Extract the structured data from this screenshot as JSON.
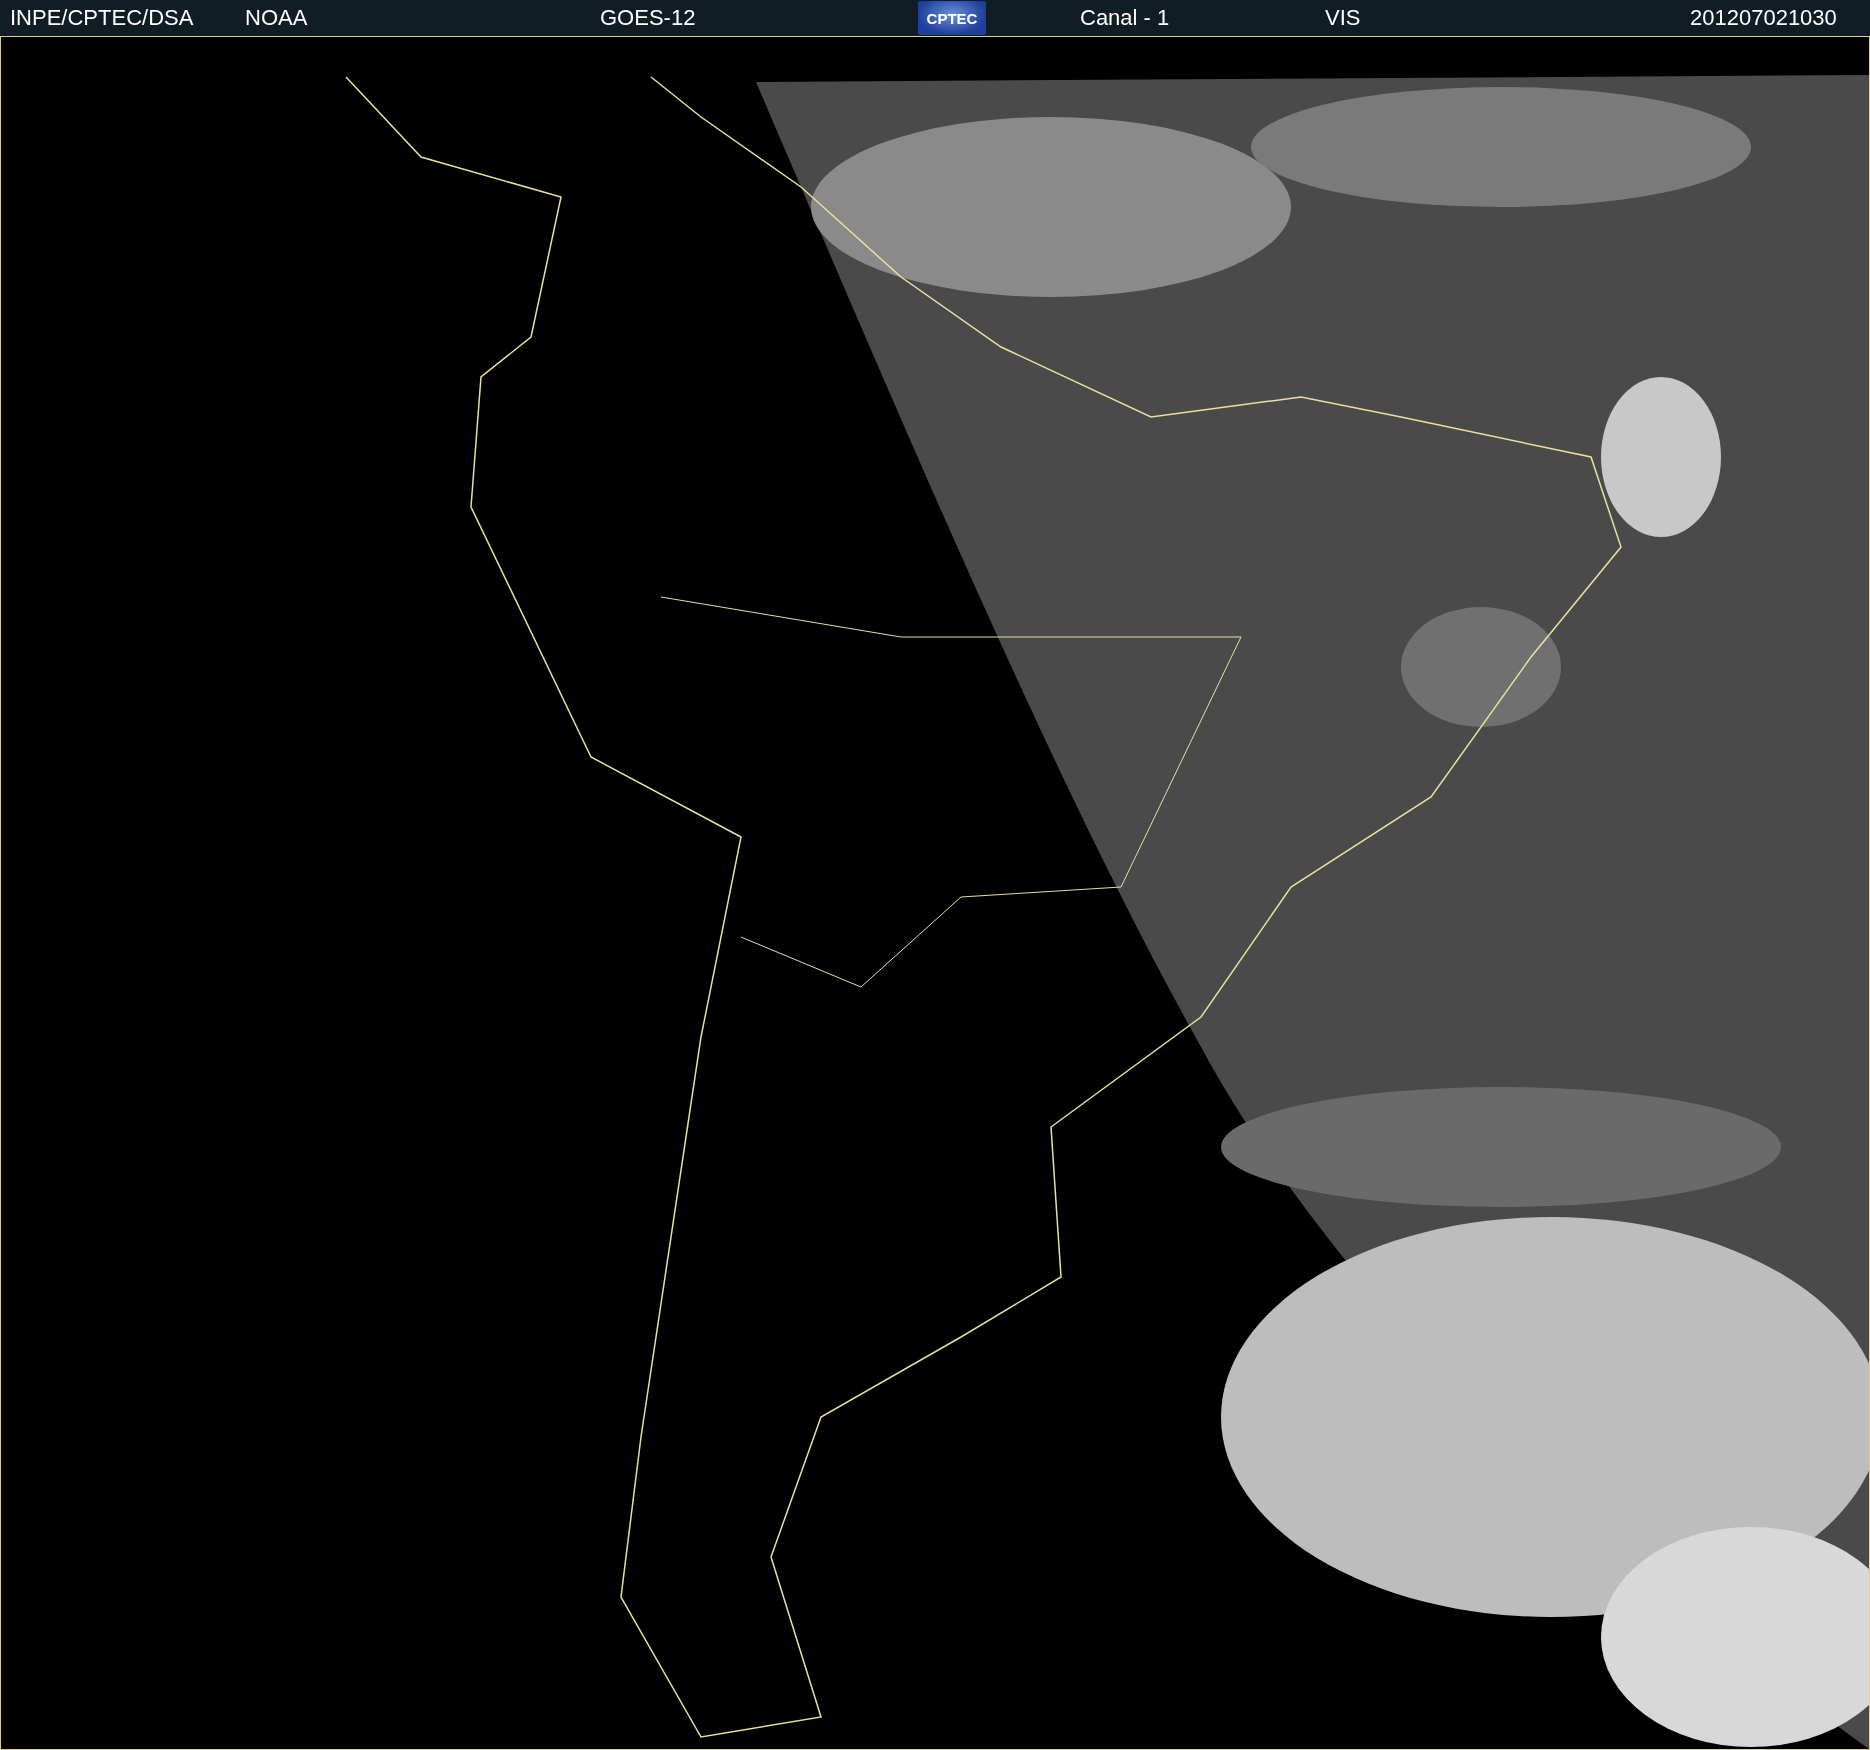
{
  "header": {
    "items": [
      {
        "kind": "text",
        "label": "INPE/CPTEC/DSA"
      },
      {
        "kind": "text",
        "label": "NOAA"
      },
      {
        "kind": "text",
        "label": "GOES-12"
      },
      {
        "kind": "logo",
        "label": "CPTEC"
      },
      {
        "kind": "text",
        "label": "Canal - 1"
      },
      {
        "kind": "text",
        "label": "VIS"
      },
      {
        "kind": "text",
        "label": "201207021030"
      }
    ]
  }
}
